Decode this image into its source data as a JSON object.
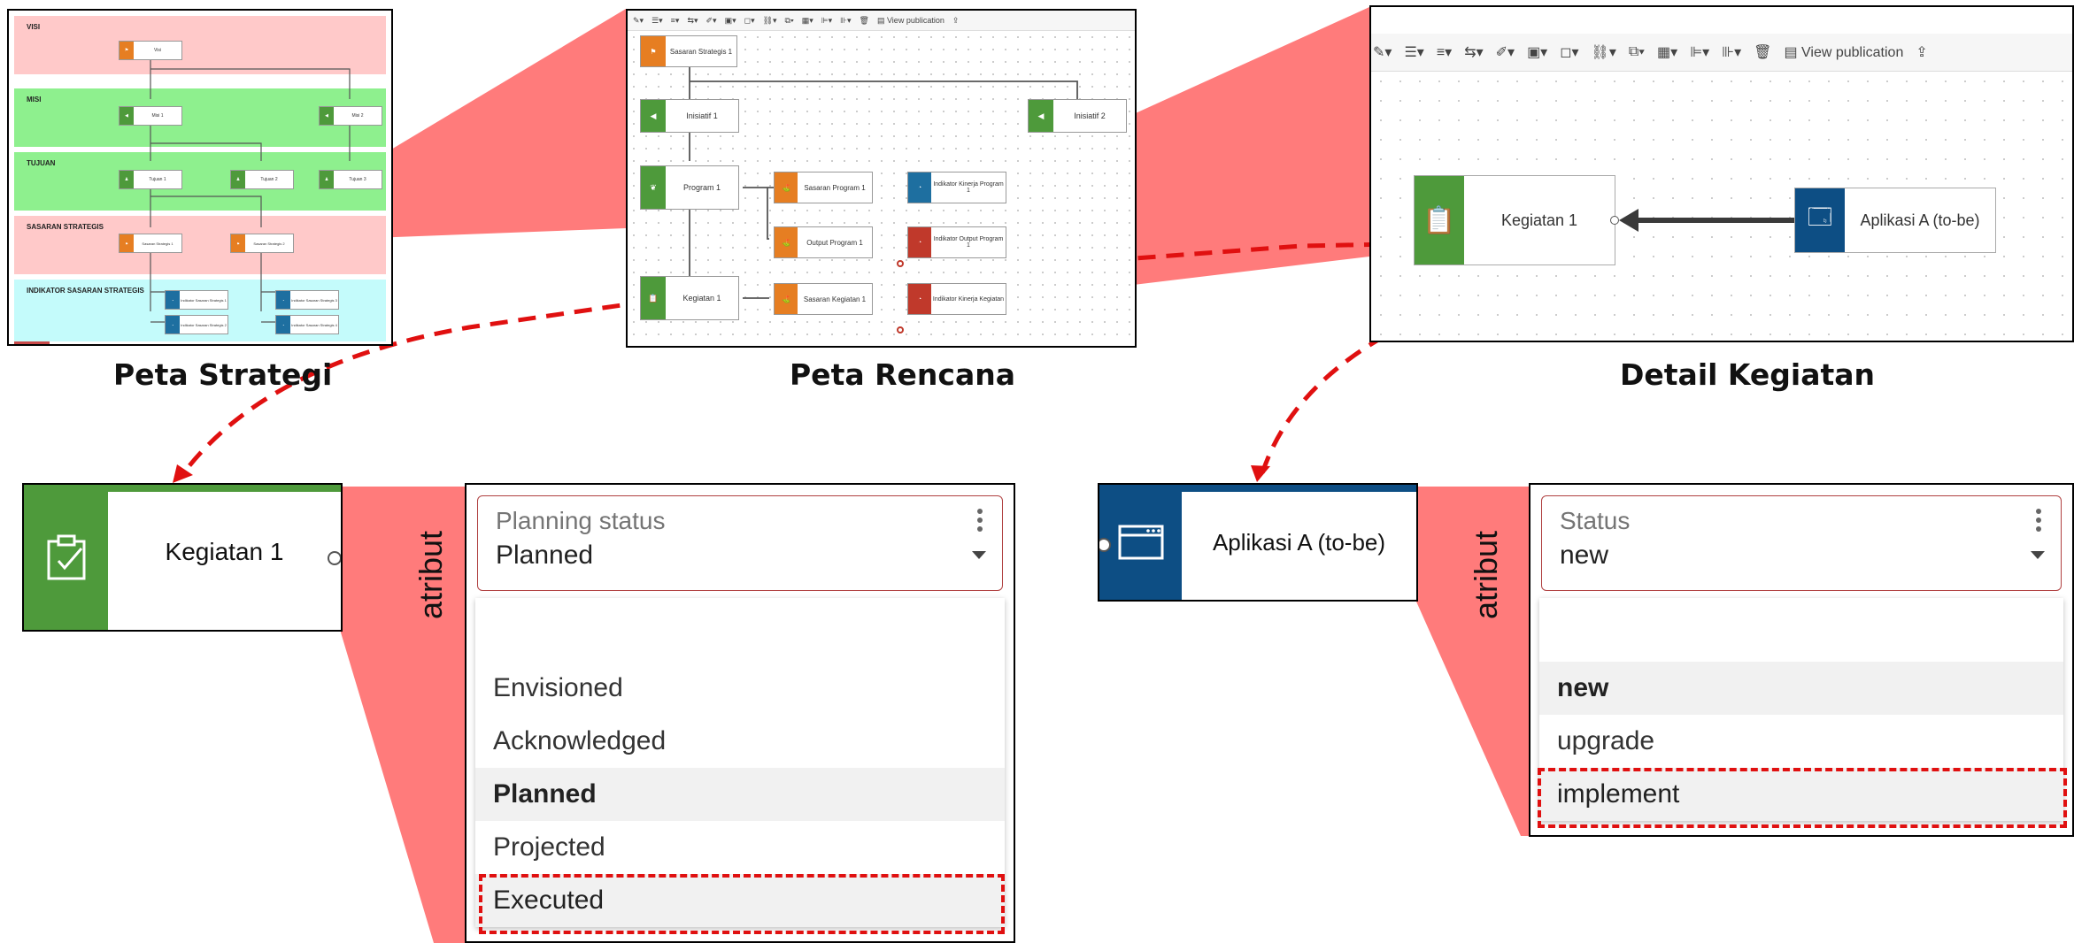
{
  "captions": {
    "peta_strategi": "Peta Strategi",
    "peta_rencana": "Peta Rencana",
    "detail_kegiatan": "Detail Kegiatan"
  },
  "colors": {
    "zoom_wedge": "#ff7b7b",
    "lane_pink": "#ffc9c9",
    "lane_green": "#8ef08e",
    "lane_cyan": "#c4fbfb",
    "node_orange": "#e67e22",
    "node_green": "#4e9a3b",
    "node_blue": "#1e6fa0",
    "node_navy": "#0d4e84",
    "node_red": "#c0392b",
    "dashed_red": "#e01010"
  },
  "strategy_map": {
    "lanes": [
      "VISI",
      "MISI",
      "TUJUAN",
      "SASARAN STRATEGIS",
      "INDIKATOR SASARAN STRATEGIS"
    ],
    "nodes": {
      "visi": "Visi",
      "misi_1": "Misi 1",
      "misi_2": "Misi 2",
      "tujuan_1": "Tujuan 1",
      "tujuan_2": "Tujuan 2",
      "tujuan_3": "Tujuan 3",
      "sasaran_1": "Sasaran Strategis 1",
      "sasaran_2": "Sasaran Strategis 2",
      "indikator_1": "Indikator Sasaran Strategis 1",
      "indikator_2": "Indikator Sasaran Strategis 2",
      "indikator_3": "Indikator Sasaran Strategis 3",
      "indikator_4": "Indikator Sasaran Strategis 4"
    }
  },
  "plan_map": {
    "toolbar_view": "View publication",
    "nodes": {
      "sasaran_strategis": "Sasaran Strategis 1",
      "inisiatif_1": "Inisiatif 1",
      "inisiatif_2": "Inisiatif 2",
      "program_1": "Program 1",
      "sasaran_program": "Sasaran Program 1",
      "output_program": "Output Program 1",
      "indikator_kinerja_program": "Indikator Kinerja Program 1",
      "indikator_output_program": "Indikator Output Program 1",
      "kegiatan": "Kegiatan 1",
      "sasaran_kegiatan": "Sasaran Kegiatan 1",
      "indikator_kinerja_kegiatan": "Indikator Kinerja Kegiatan"
    }
  },
  "detail_map": {
    "toolbar_view": "View publication",
    "kegiatan": "Kegiatan 1",
    "aplikasi": "Aplikasi A (to-be)"
  },
  "zoom_cards": {
    "kegiatan": "Kegiatan 1",
    "aplikasi": "Aplikasi A (to-be)"
  },
  "atribut_label_left": "atribut",
  "atribut_label_right": "atribut",
  "planning_dropdown": {
    "label": "Planning status",
    "value": "Planned",
    "options": [
      "Envisioned",
      "Acknowledged",
      "Planned",
      "Projected",
      "Executed"
    ],
    "selected": "Planned",
    "highlighted": "Executed"
  },
  "status_dropdown": {
    "label": "Status",
    "value": "new",
    "options": [
      "new",
      "upgrade",
      "implement"
    ],
    "selected": "new",
    "highlighted": "implement"
  }
}
